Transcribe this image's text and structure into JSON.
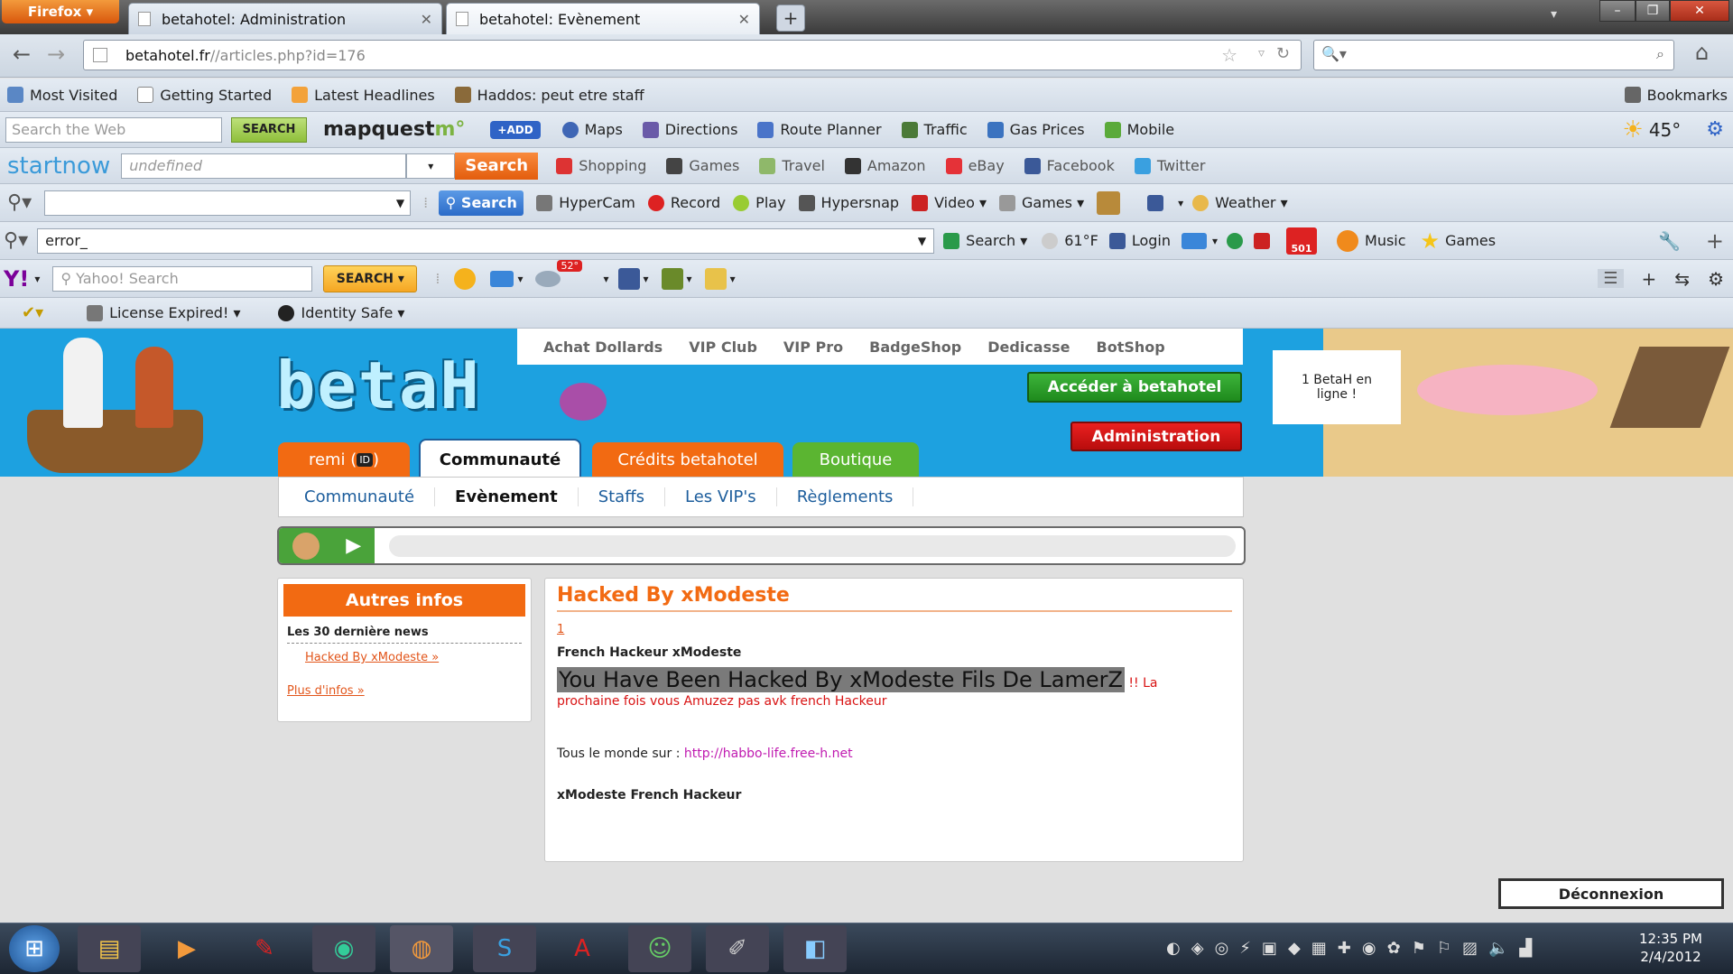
{
  "browser": {
    "menu_label": "Firefox",
    "tabs": [
      {
        "title": "betahotel: Administration"
      },
      {
        "title": "betahotel: Evènement"
      }
    ],
    "url_domain": "betahotel.fr",
    "url_path": "//articles.php?id=176"
  },
  "bookmarks": {
    "items": [
      "Most Visited",
      "Getting Started",
      "Latest Headlines",
      "Haddos: peut etre staff"
    ],
    "right_label": "Bookmarks"
  },
  "mapquest_bar": {
    "search_placeholder": "Search the Web",
    "search_btn": "SEARCH",
    "brand": "mapquest",
    "add": "+ADD",
    "links": [
      "Maps",
      "Directions",
      "Route Planner",
      "Traffic",
      "Gas Prices",
      "Mobile"
    ],
    "temp": "45°"
  },
  "startnow_bar": {
    "brand": "startnow",
    "input_value": "undefined",
    "search_btn": "Search",
    "links": [
      "Shopping",
      "Games",
      "Travel",
      "Amazon",
      "eBay",
      "Facebook",
      "Twitter"
    ]
  },
  "hypercam_bar": {
    "search_btn": "Search",
    "links": [
      "HyperCam",
      "Record",
      "Play",
      "Hypersnap",
      "Video",
      "Games",
      "Weather"
    ]
  },
  "error_bar": {
    "input_value": "error_",
    "links": [
      "Search",
      "61°F",
      "Login",
      "Music",
      "Games"
    ],
    "badge": "501"
  },
  "yahoo_bar": {
    "logo": "Y!",
    "search_placeholder": "Yahoo! Search",
    "search_btn": "SEARCH",
    "temp": "52°"
  },
  "security_bar": {
    "license": "License Expired!",
    "identity": "Identity Safe"
  },
  "site": {
    "logo": "betaH",
    "top_menu": [
      "Achat Dollards",
      "VIP Club",
      "VIP Pro",
      "BadgeShop",
      "Dedicasse",
      "BotShop"
    ],
    "access_btn": "Accéder à betahotel",
    "admin_btn": "Administration",
    "online": "1 BetaH en ligne !",
    "nav_tabs": [
      "remi",
      "Communauté",
      "Crédits betahotel",
      "Boutique"
    ],
    "user_badge": "ID",
    "sub_nav": [
      "Communauté",
      "Evènement",
      "Staffs",
      "Les VIP's",
      "Règlements"
    ],
    "side": {
      "title": "Autres infos",
      "subtitle": "Les 30 dernière news",
      "link": "Hacked By xModeste »",
      "more": "Plus d'infos »"
    },
    "article": {
      "title": "Hacked By xModeste",
      "page_link": "1",
      "line1": "French Hackeur xModeste",
      "big": "You Have Been Hacked By xModeste Fils De LamerZ",
      "red_a": "!! La",
      "red_b": "prochaine fois vous Amuzez pas avk french Hackeur",
      "line3_prefix": "Tous le monde sur : ",
      "line3_link": "http://habbo-life.free-h.net",
      "line4": "xModeste French Hackeur"
    },
    "logout": "Déconnexion"
  },
  "taskbar": {
    "time": "12:35 PM",
    "date": "2/4/2012"
  },
  "colors": {
    "orange": "#f26a12",
    "header_blue": "#1da1e0",
    "green": "#3aa12b",
    "red": "#d81212"
  }
}
